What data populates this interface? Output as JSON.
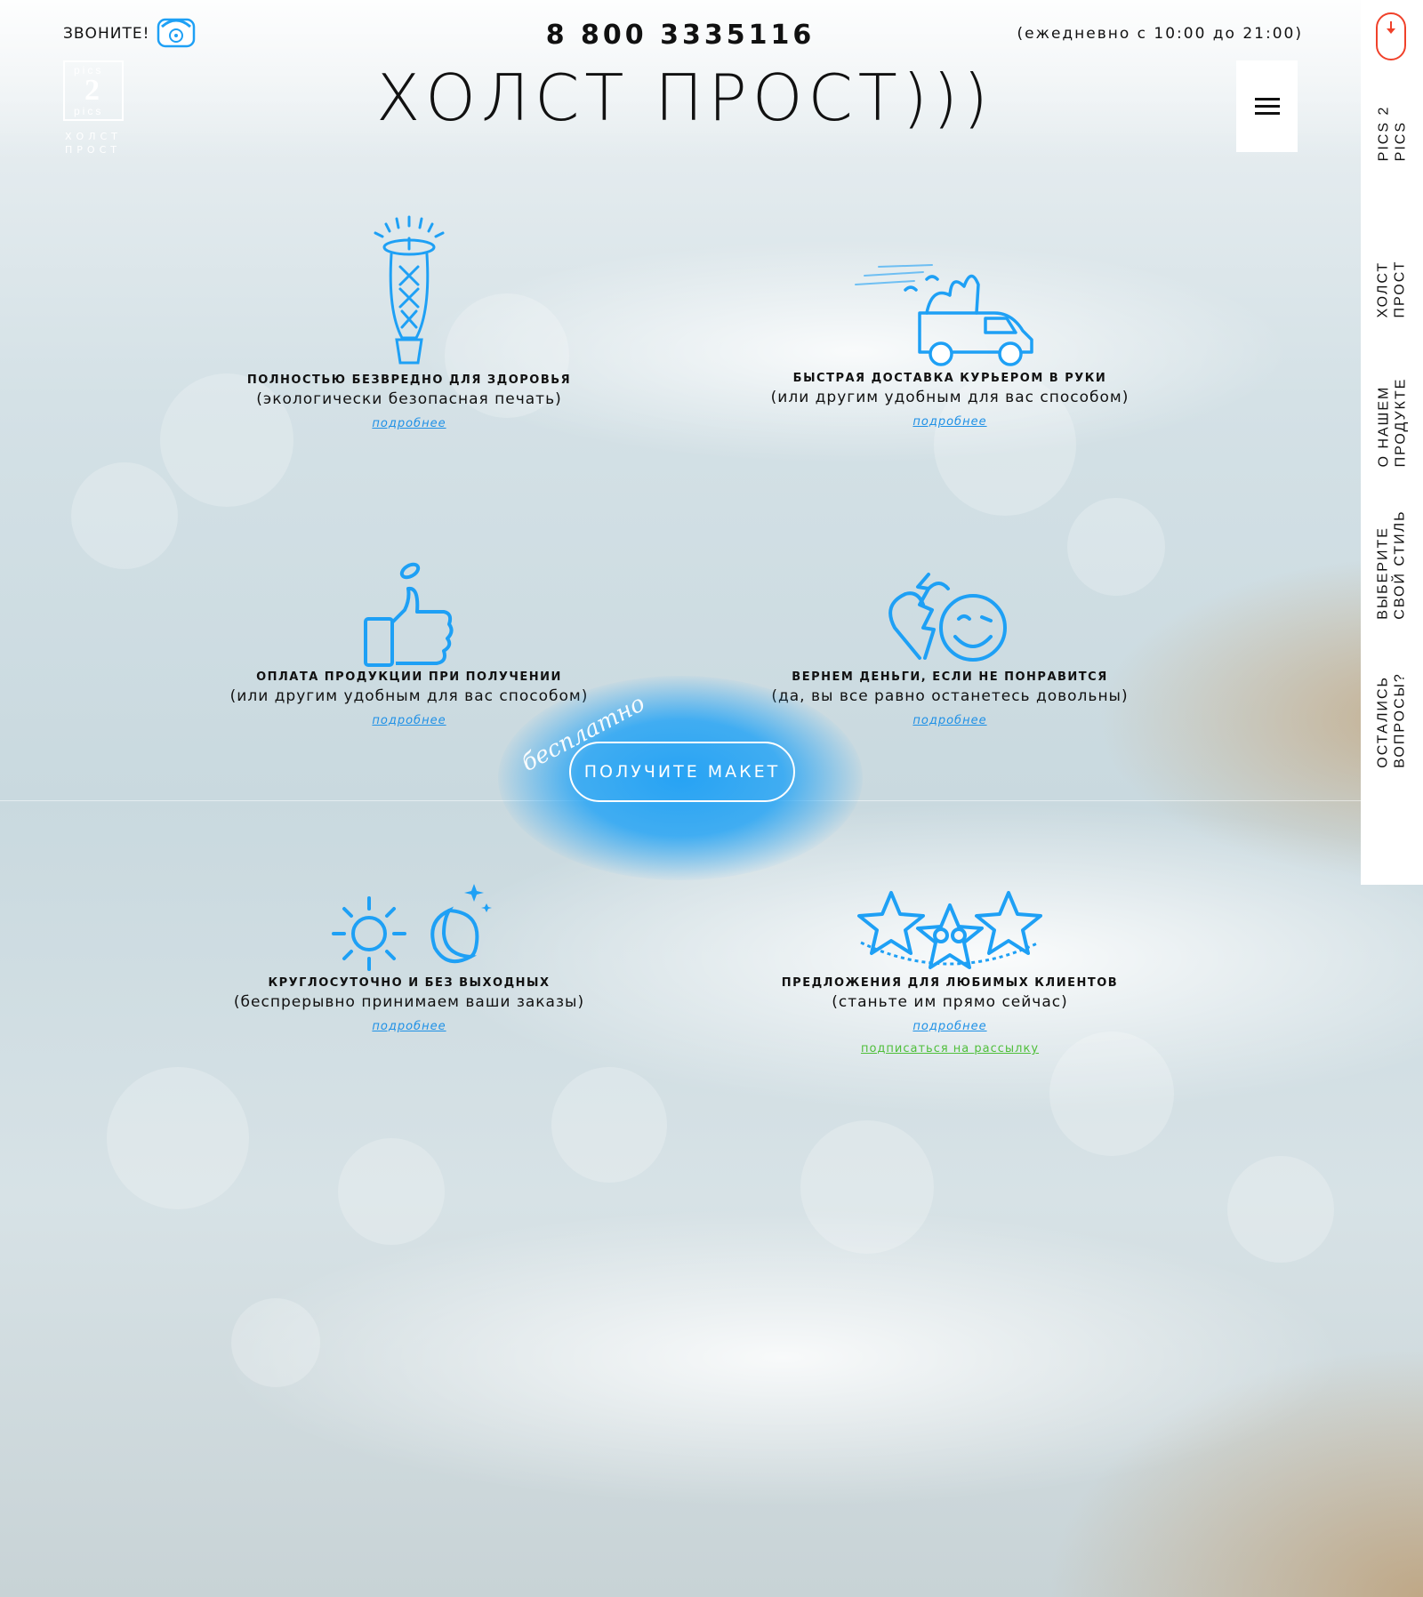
{
  "header": {
    "call_label": "ЗВОНИТЕ!",
    "phone": "8 800 3335116",
    "hours": "(ежедневно с 10:00 до 21:00)",
    "title": "ХОЛСТ ПРОСТ)))",
    "logo": {
      "line1": "pics",
      "digit": "2",
      "line3": "pics",
      "brand_line1": "ХОЛСТ",
      "brand_line2": "ПРОСТ"
    }
  },
  "side_nav": {
    "items": [
      "PICS 2\nPICS",
      "ХОЛСТ\nПРОСТ",
      "О НАШЕМ\nПРОДУКТЕ",
      "ВЫБЕРИТЕ\nСВОЙ СТИЛЬ",
      "ОСТАЛИСЬ\nВОПРОСЫ?"
    ]
  },
  "features": [
    {
      "icon": "grass-plant-icon",
      "title": "ПОЛНОСТЬЮ БЕЗВРЕДНО ДЛЯ ЗДОРОВЬЯ",
      "subtitle": "(экологически безопасная печать)",
      "link": "подробнее"
    },
    {
      "icon": "delivery-van-icon",
      "title": "БЫСТРАЯ ДОСТАВКА КУРЬЕРОМ В РУКИ",
      "subtitle": "(или другим удобным для вас способом)",
      "link": "подробнее"
    },
    {
      "icon": "thumbs-up-icon",
      "title": "ОПЛАТА ПРОДУКЦИИ ПРИ ПОЛУЧЕНИИ",
      "subtitle": "(или другим удобным для вас способом)",
      "link": "подробнее"
    },
    {
      "icon": "broken-heart-smile-icon",
      "title": "ВЕРНЕМ ДЕНЬГИ, ЕСЛИ НЕ ПОНРАВИТСЯ",
      "subtitle": "(да, вы все равно останетесь довольны)",
      "link": "подробнее"
    },
    {
      "icon": "sun-moon-icon",
      "title": "КРУГЛОСУТОЧНО И БЕЗ ВЫХОДНЫХ",
      "subtitle": "(беспрерывно принимаем ваши заказы)",
      "link": "подробнее"
    },
    {
      "icon": "stars-icon",
      "title": "ПРЕДЛОЖЕНИЯ ДЛЯ ЛЮБИМЫХ КЛИЕНТОВ",
      "subtitle": "(станьте им прямо сейчас)",
      "link": "подробнее",
      "extra_link": "подписаться на рассылку"
    }
  ],
  "cta": {
    "label": "ПОЛУЧИТЕ МАКЕТ",
    "tag": "бесплатно"
  },
  "colors": {
    "accent_blue": "#1ea0f5",
    "nav_red": "#f0412a",
    "green_link": "#4fbf3a"
  }
}
